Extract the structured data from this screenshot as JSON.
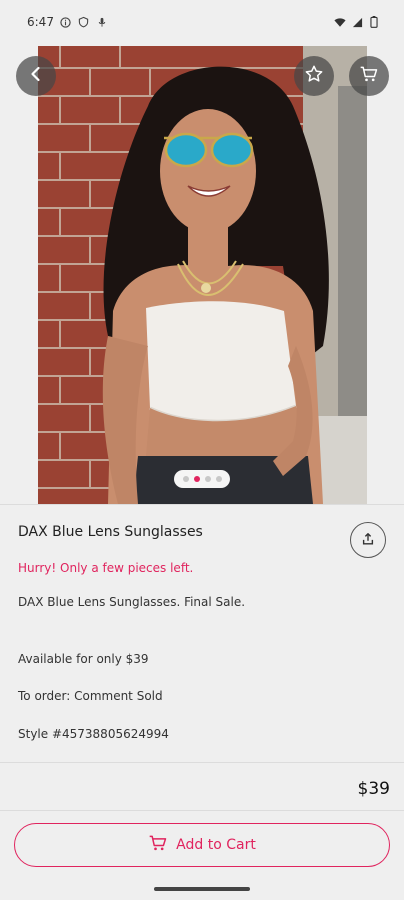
{
  "status_bar": {
    "time": "6:47",
    "icons_left": [
      "info-icon",
      "shield-icon",
      "mic-icon"
    ],
    "icons_right": [
      "wifi-icon",
      "signal-icon",
      "battery-icon"
    ]
  },
  "hero": {
    "back_icon": "chevron-left-icon",
    "favorite_icon": "star-outline-icon",
    "cart_icon": "cart-icon",
    "image_alt": "Woman wearing blue lens sunglasses and white crop top in front of brick wall",
    "carousel": {
      "count": 4,
      "active_index": 1
    }
  },
  "product": {
    "title": "DAX Blue Lens Sunglasses",
    "urgency": "Hurry! Only a few pieces left.",
    "description_lines": [
      "DAX Blue Lens Sunglasses. Final Sale.",
      "Available for only $39",
      "To order: Comment Sold",
      "Style #45738805624994"
    ],
    "share_icon": "share-icon",
    "price": "$39"
  },
  "cta": {
    "add_to_cart_label": "Add to Cart",
    "accent": "#e0245e"
  }
}
